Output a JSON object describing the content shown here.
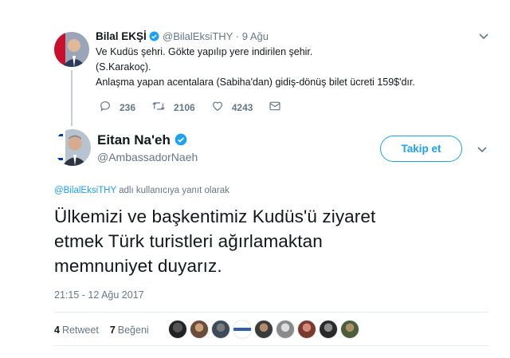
{
  "original_tweet": {
    "author_name": "Bilal EKŞİ",
    "author_handle": "@BilalEksiTHY",
    "separator": "·",
    "date": "9 Ağu",
    "lines": [
      "Ve Kudüs şehri. Gökte yapılıp yere indirilen şehir.",
      "(S.Karakoç).",
      "Anlaşma yapan acentalara (Sabiha'dan) gidiş-dönüş bilet ücreti 159$'dır."
    ],
    "replies": "236",
    "retweets": "2106",
    "likes": "4243"
  },
  "reply_tweet": {
    "author_name": "Eitan Na'eh",
    "author_handle": "@AmbassadorNaeh",
    "follow_label": "Takip et",
    "reply_to_handle": "@BilalEksiTHY",
    "reply_to_suffix": " adlı kullanıcıya yanıt olarak",
    "body_lines": [
      "Ülkemizi ve başkentimiz Kudüs'ü ziyaret",
      "etmek Türk turistleri ağırlamaktan",
      "memnuniyet duyarız."
    ],
    "timestamp": "21:15 - 12 Ağu 2017",
    "retweet_count": "4",
    "retweet_label": "Retweet",
    "like_count": "7",
    "like_label": "Beğeni"
  },
  "colors": {
    "accent": "#1da1f2",
    "text": "#14171a",
    "secondary": "#657786"
  },
  "icons": [
    "verified-badge-icon",
    "chevron-down-icon",
    "reply-icon",
    "retweet-icon",
    "heart-icon",
    "direct-message-icon"
  ]
}
